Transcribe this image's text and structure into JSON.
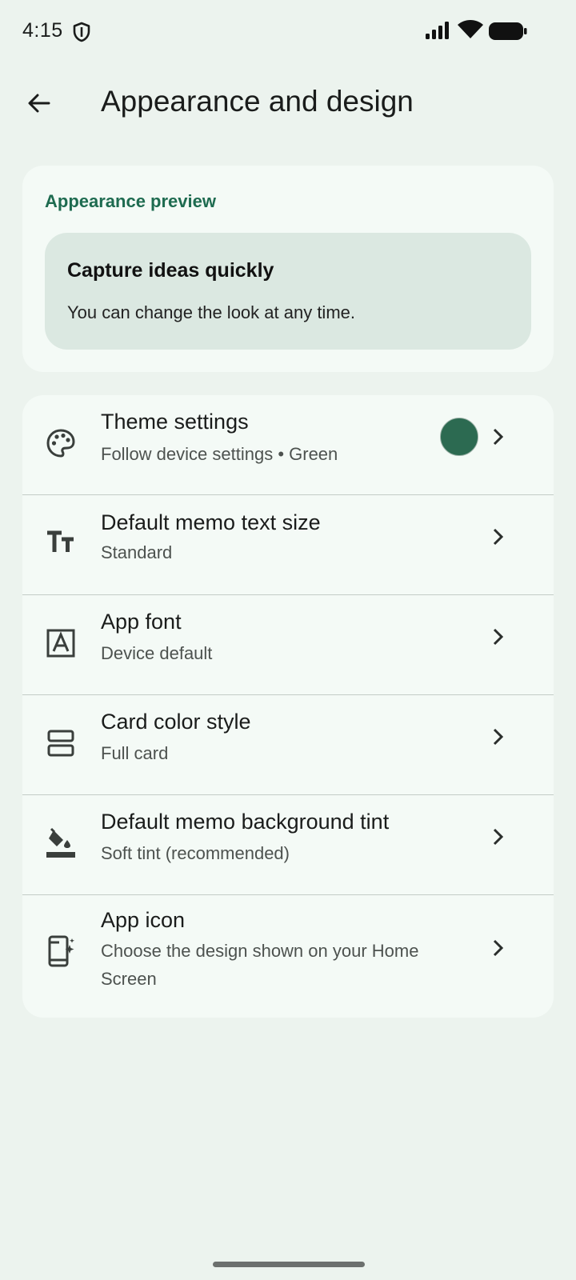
{
  "status_bar": {
    "time": "4:15",
    "icons": [
      "shield-icon",
      "signal-icon",
      "wifi-icon",
      "battery-icon"
    ]
  },
  "app_bar": {
    "title": "Appearance and design",
    "back_icon": "arrow-back-icon"
  },
  "preview": {
    "label": "Appearance preview",
    "heading": "Capture ideas quickly",
    "body": "You can change the look at any time."
  },
  "settings": {
    "items": [
      {
        "icon": "palette-icon",
        "title": "Theme settings",
        "subtitle": "Follow device settings • Green",
        "swatch_color": "#2c6a51"
      },
      {
        "icon": "text-size-icon",
        "title": "Default memo text size",
        "subtitle": "Standard"
      },
      {
        "icon": "font-icon",
        "title": "App font",
        "subtitle": "Device default"
      },
      {
        "icon": "card-style-icon",
        "title": "Card color style",
        "subtitle": "Full card"
      },
      {
        "icon": "paint-bucket-icon",
        "title": "Default memo background tint",
        "subtitle": "Soft tint (recommended)"
      },
      {
        "icon": "app-icon-icon",
        "title": "App icon",
        "subtitle": "Choose the design shown on your Home Screen"
      }
    ]
  },
  "colors": {
    "background": "#ecf3ee",
    "surface": "#f4faf6",
    "accent": "#1e6b50",
    "preview_surface": "#dbe8e1"
  }
}
